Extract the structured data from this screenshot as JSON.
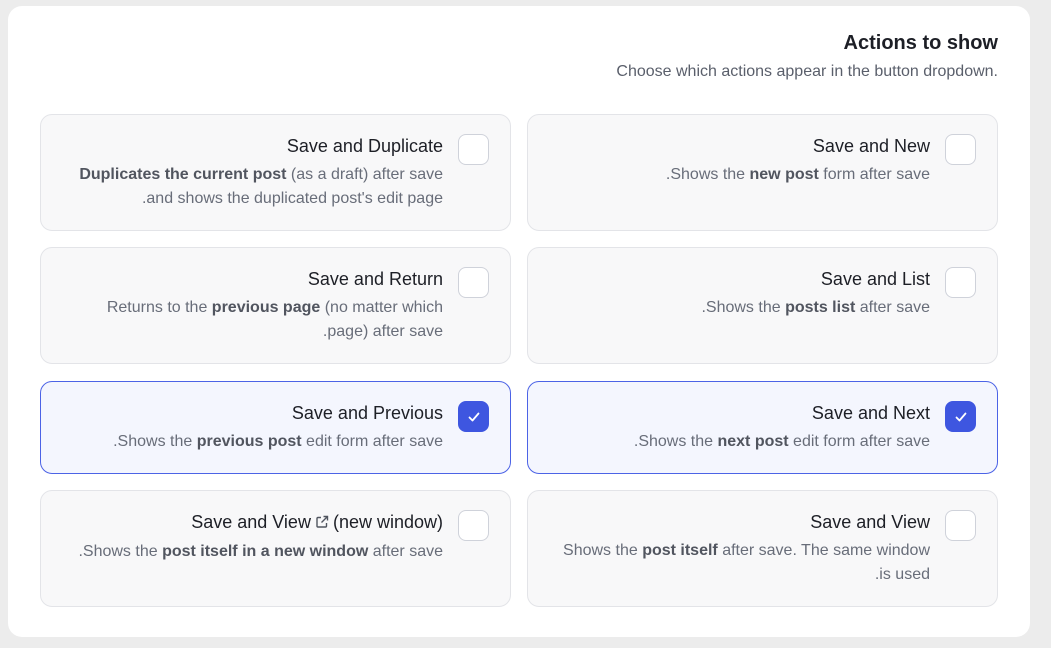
{
  "header": {
    "title": "Actions to show",
    "subtitle": ".Choose which actions appear in the button dropdown"
  },
  "colors": {
    "accent": "#3e56e0",
    "card_border": "#e3e4e8",
    "checked_background": "#f4f6fe"
  },
  "options": [
    {
      "title": "Save and New",
      "checked": false,
      "desc_lines": [
        [
          {
            "t": "Shows the ",
            "b": false
          },
          {
            "t": "new post",
            "b": true
          },
          {
            "t": " form after save.",
            "b": false
          }
        ]
      ]
    },
    {
      "title": "Save and Duplicate",
      "checked": false,
      "desc_lines": [
        [
          {
            "t": "Duplicates the current post",
            "b": true
          },
          {
            "t": " (as a draft) after save",
            "b": false
          }
        ],
        [
          {
            "t": "and shows the duplicated post's edit page.",
            "b": false
          }
        ]
      ]
    },
    {
      "title": "Save and List",
      "checked": false,
      "desc_lines": [
        [
          {
            "t": "Shows the ",
            "b": false
          },
          {
            "t": "posts list",
            "b": true
          },
          {
            "t": " after save.",
            "b": false
          }
        ]
      ]
    },
    {
      "title": "Save and Return",
      "checked": false,
      "desc_lines": [
        [
          {
            "t": "Returns to the ",
            "b": false
          },
          {
            "t": "previous page",
            "b": true
          },
          {
            "t": " (no matter which",
            "b": false
          }
        ],
        [
          {
            "t": "page) after save.",
            "b": false
          }
        ]
      ]
    },
    {
      "title": "Save and Next",
      "checked": true,
      "desc_lines": [
        [
          {
            "t": "Shows the ",
            "b": false
          },
          {
            "t": "next post",
            "b": true
          },
          {
            "t": " edit form after save.",
            "b": false
          }
        ]
      ]
    },
    {
      "title": "Save and Previous",
      "checked": true,
      "desc_lines": [
        [
          {
            "t": "Shows the ",
            "b": false
          },
          {
            "t": "previous post",
            "b": true
          },
          {
            "t": " edit form after save.",
            "b": false
          }
        ]
      ]
    },
    {
      "title": "Save and View",
      "checked": false,
      "desc_lines": [
        [
          {
            "t": "Shows the ",
            "b": false
          },
          {
            "t": "post itself",
            "b": true
          },
          {
            "t": " after save. The same window",
            "b": false
          }
        ],
        [
          {
            "t": "is used.",
            "b": false
          }
        ]
      ]
    },
    {
      "title": "Save and View",
      "title_suffix": "(new window)",
      "title_icon": "external-link-icon",
      "checked": false,
      "desc_lines": [
        [
          {
            "t": "Shows the ",
            "b": false
          },
          {
            "t": "post itself in a new window",
            "b": true
          },
          {
            "t": " after save.",
            "b": false
          }
        ]
      ]
    }
  ]
}
